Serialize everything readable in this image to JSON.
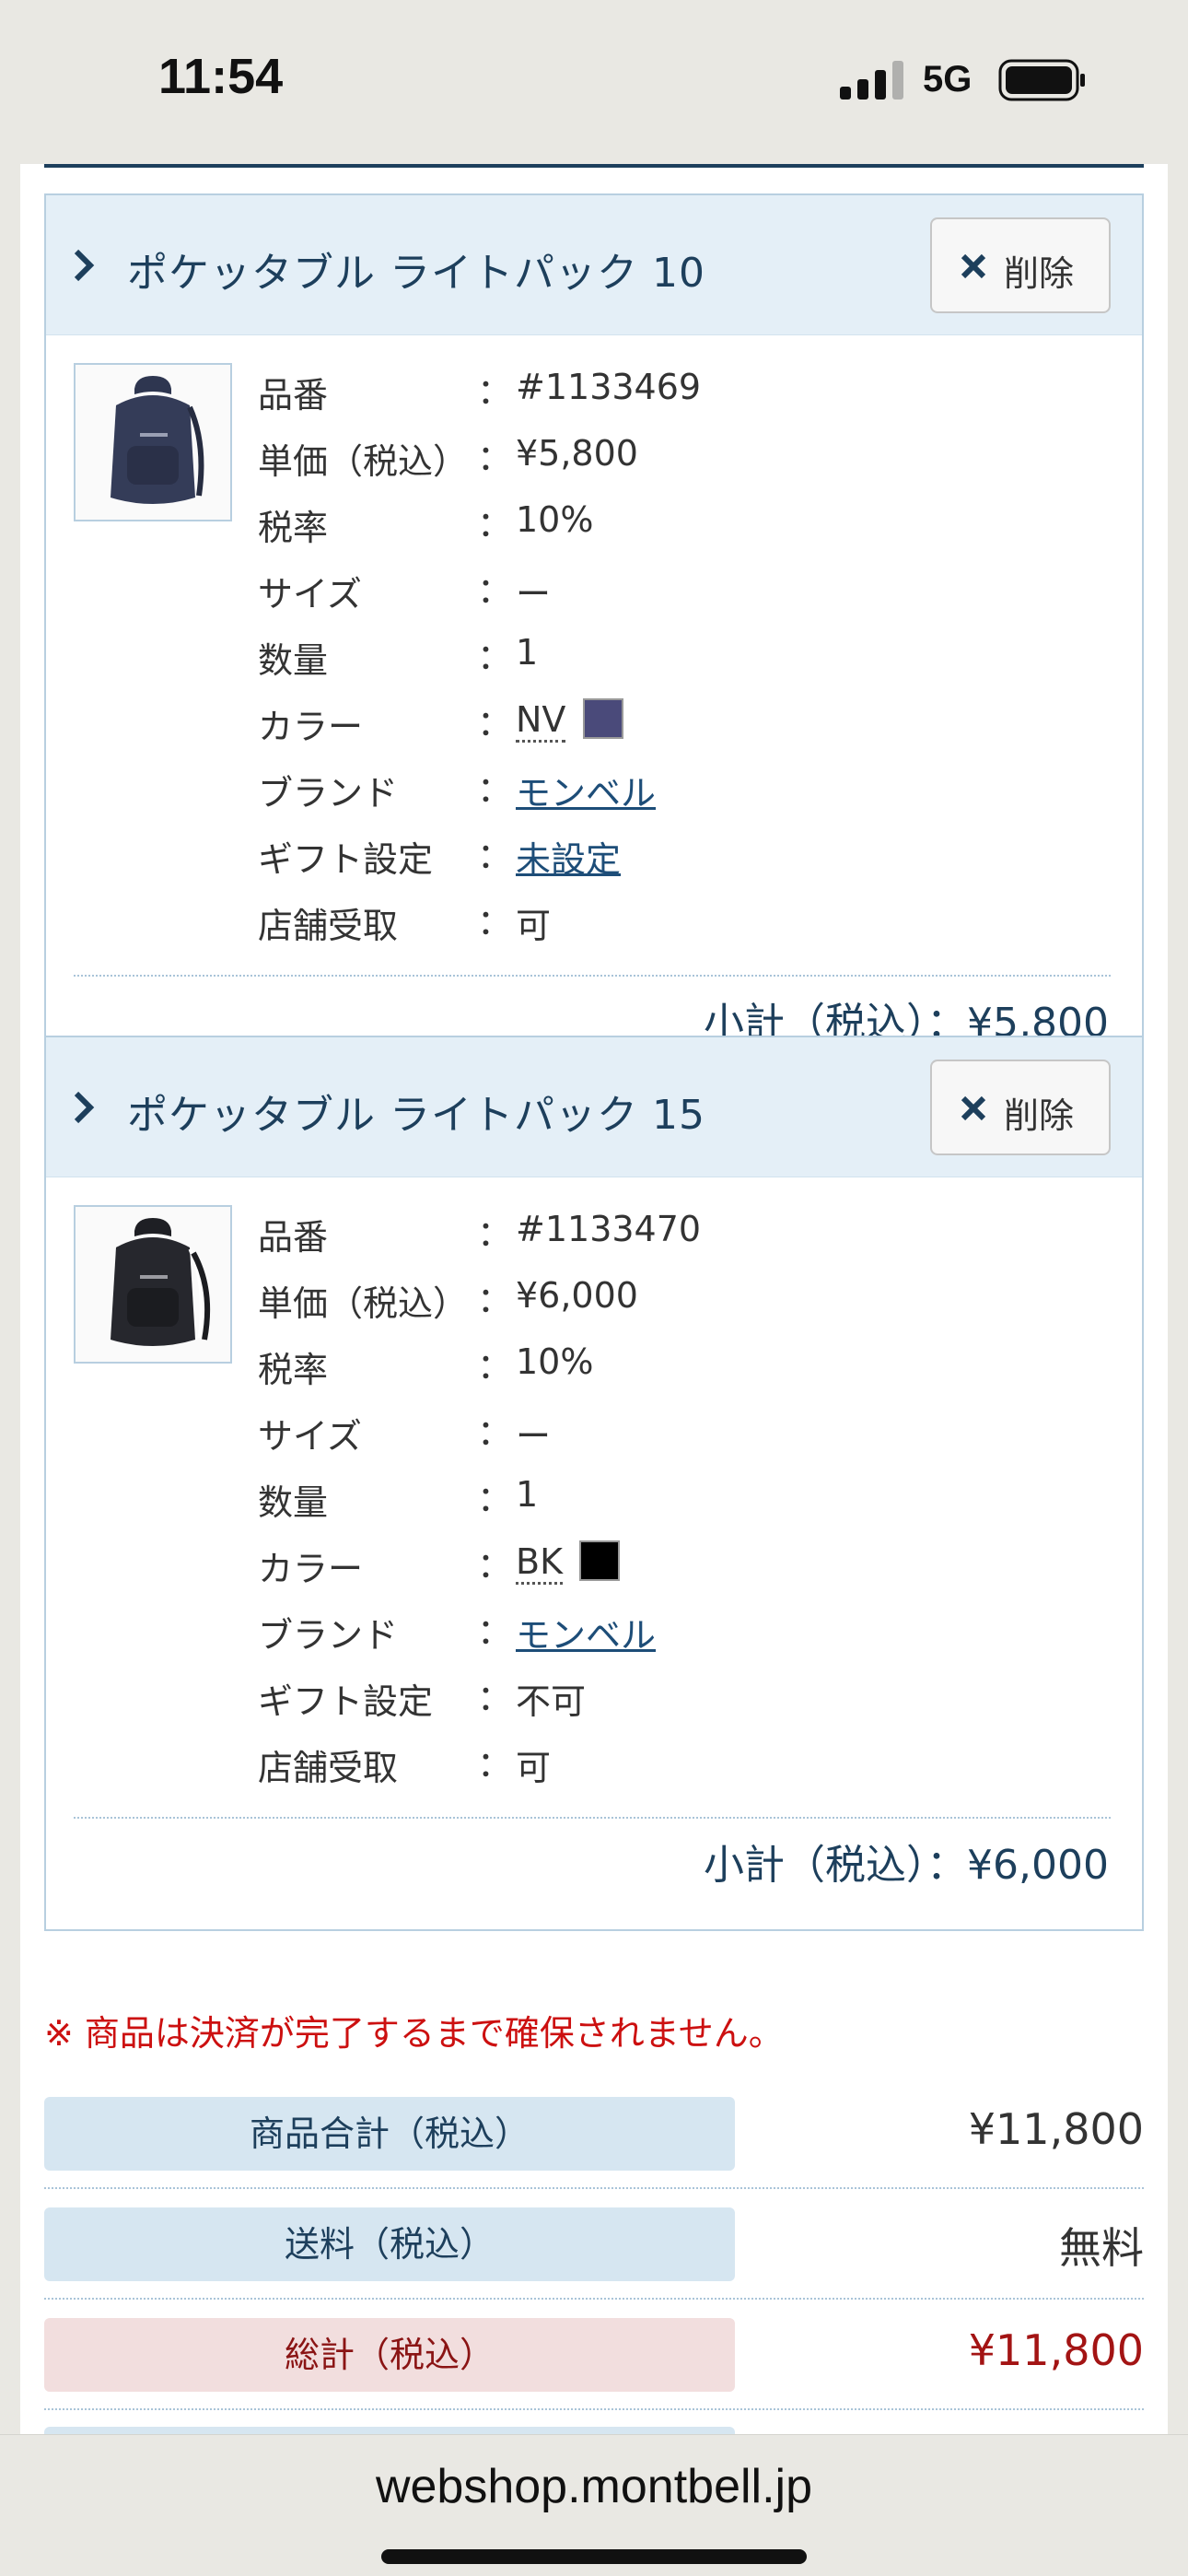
{
  "status_bar": {
    "time": "11:54",
    "network": "5G"
  },
  "cart": {
    "items": [
      {
        "name": "ポケッタブル ライトパック 10",
        "delete_label": "削除",
        "image": "backpack-navy",
        "specs": {
          "part_no": {
            "label": "品番",
            "value": "#1133469"
          },
          "unit_price": {
            "label": "単価（税込）",
            "value": "¥5,800"
          },
          "tax_rate": {
            "label": "税率",
            "value": "10%"
          },
          "size": {
            "label": "サイズ",
            "value": "ー"
          },
          "quantity": {
            "label": "数量",
            "value": "1"
          },
          "color": {
            "label": "カラー",
            "value": "NV",
            "swatch": "#4a4a7a"
          },
          "brand": {
            "label": "ブランド",
            "value": "モンベル"
          },
          "gift": {
            "label": "ギフト設定",
            "value": "未設定"
          },
          "store_pickup": {
            "label": "店舗受取",
            "value": "可"
          }
        },
        "subtotal": "小計（税込）：¥5,800"
      },
      {
        "name": "ポケッタブル ライトパック 15",
        "delete_label": "削除",
        "image": "backpack-black",
        "specs": {
          "part_no": {
            "label": "品番",
            "value": "#1133470"
          },
          "unit_price": {
            "label": "単価（税込）",
            "value": "¥6,000"
          },
          "tax_rate": {
            "label": "税率",
            "value": "10%"
          },
          "size": {
            "label": "サイズ",
            "value": "ー"
          },
          "quantity": {
            "label": "数量",
            "value": "1"
          },
          "color": {
            "label": "カラー",
            "value": "BK",
            "swatch": "#000000"
          },
          "brand": {
            "label": "ブランド",
            "value": "モンベル"
          },
          "gift": {
            "label": "ギフト設定",
            "value": "不可"
          },
          "store_pickup": {
            "label": "店舗受取",
            "value": "可"
          }
        },
        "subtotal": "小計（税込）：¥6,000"
      }
    ],
    "colon": "："
  },
  "notice": "※ 商品は決済が完了するまで確保されません。",
  "summary": {
    "merch_total": {
      "label": "商品合計（税込）",
      "value": "¥11,800"
    },
    "shipping": {
      "label": "送料（税込）",
      "value": "無料"
    },
    "grand_total": {
      "label": "総計（税込）",
      "value": "¥11,800"
    }
  },
  "browser": {
    "url": "webshop.montbell.jp"
  },
  "colors": {
    "accent": "#1d3f5c",
    "warning": "#cc1010",
    "link": "#1d4d78"
  }
}
